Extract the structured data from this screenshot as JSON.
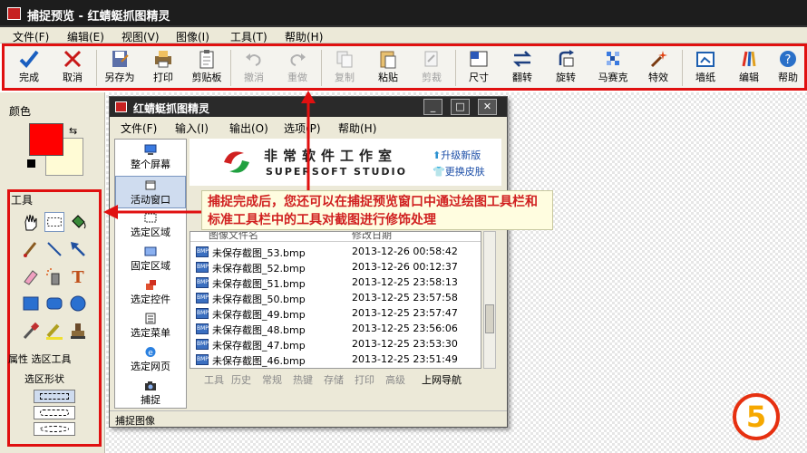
{
  "app_title": "捕捉预览 - 红蜻蜓抓图精灵",
  "menubar": [
    {
      "label": "文件(F)"
    },
    {
      "label": "编辑(E)"
    },
    {
      "label": "视图(V)"
    },
    {
      "label": "图像(I)"
    },
    {
      "label": "工具(T)"
    },
    {
      "label": "帮助(H)"
    }
  ],
  "toolbar": [
    {
      "label": "完成",
      "icon": "check-icon",
      "enabled": true
    },
    {
      "label": "取消",
      "icon": "cross-icon",
      "enabled": true
    },
    {
      "label": "另存为",
      "icon": "save-as-icon",
      "enabled": true
    },
    {
      "label": "打印",
      "icon": "printer-icon",
      "enabled": true
    },
    {
      "label": "剪贴板",
      "icon": "clipboard-icon",
      "enabled": true
    },
    {
      "label": "撤消",
      "icon": "undo-icon",
      "enabled": false
    },
    {
      "label": "重做",
      "icon": "redo-icon",
      "enabled": false
    },
    {
      "label": "复制",
      "icon": "copy-icon",
      "enabled": false
    },
    {
      "label": "粘贴",
      "icon": "paste-icon",
      "enabled": true
    },
    {
      "label": "剪裁",
      "icon": "crop-icon",
      "enabled": false
    },
    {
      "label": "尺寸",
      "icon": "resize-icon",
      "enabled": true
    },
    {
      "label": "翻转",
      "icon": "flip-icon",
      "enabled": true
    },
    {
      "label": "旋转",
      "icon": "rotate-icon",
      "enabled": true
    },
    {
      "label": "马赛克",
      "icon": "mosaic-icon",
      "enabled": true
    },
    {
      "label": "特效",
      "icon": "magic-wand-icon",
      "enabled": true
    },
    {
      "label": "墙纸",
      "icon": "wallpaper-icon",
      "enabled": true
    },
    {
      "label": "编辑",
      "icon": "edit-brush-icon",
      "enabled": true
    },
    {
      "label": "帮助",
      "icon": "help-icon",
      "enabled": true
    }
  ],
  "left_panel": {
    "color_label": "颜色",
    "primary_color": "#ff0000",
    "secondary_color": "#fffbd5",
    "tools_label": "工具",
    "tools": [
      "hand-icon",
      "rect-select-icon",
      "fill-bucket-icon",
      "brush-icon",
      "line-icon",
      "arrow-icon",
      "eraser-icon",
      "spray-icon",
      "text-icon",
      "rectangle-icon",
      "rounded-rect-icon",
      "ellipse-icon",
      "eyedropper-icon",
      "highlighter-icon",
      "stamp-icon"
    ],
    "props_label": "属性 选区工具",
    "shape_label": "选区形状"
  },
  "preview_window": {
    "title": "红蜻蜓抓图精灵",
    "menu": [
      "文件(F)",
      "输入(I)",
      "输出(O)",
      "选项(P)",
      "帮助(H)"
    ],
    "capture_modes": [
      "整个屏幕",
      "活动窗口",
      "选定区域",
      "固定区域",
      "选定控件",
      "选定菜单",
      "选定网页",
      "捕捉"
    ],
    "active_mode": 1,
    "brand_cn": "非常软件工作室",
    "brand_en": "SUPERSOFT STUDIO",
    "link_upgrade": "升级新版",
    "link_skin": "更换皮肤",
    "col_name": "图像文件名",
    "col_date": "修改日期",
    "files": [
      {
        "name": "未保存截图_53.bmp",
        "date": "2013-12-26 00:58:42"
      },
      {
        "name": "未保存截图_52.bmp",
        "date": "2013-12-26 00:12:37"
      },
      {
        "name": "未保存截图_51.bmp",
        "date": "2013-12-25 23:58:13"
      },
      {
        "name": "未保存截图_50.bmp",
        "date": "2013-12-25 23:57:58"
      },
      {
        "name": "未保存截图_49.bmp",
        "date": "2013-12-25 23:57:47"
      },
      {
        "name": "未保存截图_48.bmp",
        "date": "2013-12-25 23:56:06"
      },
      {
        "name": "未保存截图_47.bmp",
        "date": "2013-12-25 23:53:30"
      },
      {
        "name": "未保存截图_46.bmp",
        "date": "2013-12-25 23:51:49"
      }
    ],
    "file_icon_text": "BMP",
    "tabs": [
      "工具",
      "历史",
      "常规",
      "热键",
      "存储",
      "打印",
      "高级",
      "上网导航"
    ],
    "selected_tab": 7,
    "status": "捕捉图像"
  },
  "callout": "捕捉完成后，您还可以在捕捉预览窗口中通过绘图工具栏和标准工具栏中的工具对截图进行修饰处理",
  "step_number": "5",
  "accent_color": "#e01010"
}
